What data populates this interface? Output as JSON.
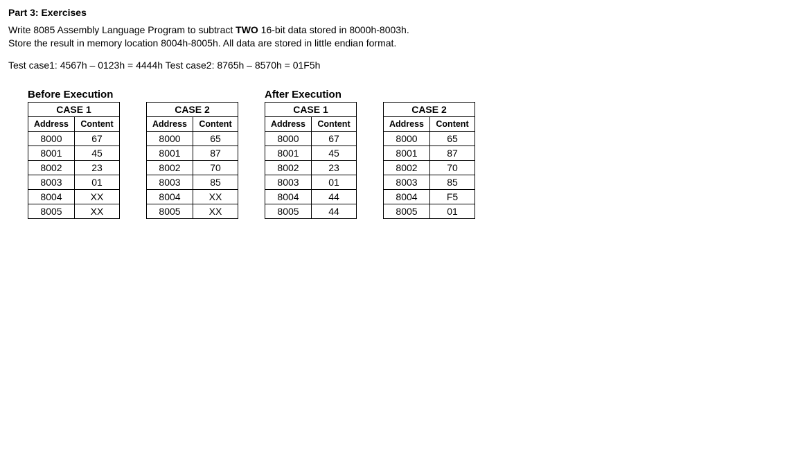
{
  "heading": "Part 3: Exercises",
  "desc_pre": "Write 8085 Assembly Language Program to subtract ",
  "two": "TWO",
  "desc_post": " 16-bit data stored in 8000h-8003h.",
  "desc_line2": "Store the result in memory location 8004h-8005h. All data are stored in little endian format.",
  "testcases": "Test case1: 4567h – 0123h = 4444h Test case2: 8765h – 8570h = 01F5h",
  "before_label": "Before Execution",
  "after_label": "After Execution",
  "addr_hdr": "Address",
  "cont_hdr": "Content",
  "before": [
    {
      "case_label": "CASE 1",
      "rows": [
        {
          "a": "8000",
          "c": "67"
        },
        {
          "a": "8001",
          "c": "45"
        },
        {
          "a": "8002",
          "c": "23"
        },
        {
          "a": "8003",
          "c": "01"
        },
        {
          "a": "8004",
          "c": "XX"
        },
        {
          "a": "8005",
          "c": "XX"
        }
      ]
    },
    {
      "case_label": "CASE 2",
      "rows": [
        {
          "a": "8000",
          "c": "65"
        },
        {
          "a": "8001",
          "c": "87"
        },
        {
          "a": "8002",
          "c": "70"
        },
        {
          "a": "8003",
          "c": "85"
        },
        {
          "a": "8004",
          "c": "XX"
        },
        {
          "a": "8005",
          "c": "XX"
        }
      ]
    }
  ],
  "after": [
    {
      "case_label": "CASE 1",
      "rows": [
        {
          "a": "8000",
          "c": "67"
        },
        {
          "a": "8001",
          "c": "45"
        },
        {
          "a": "8002",
          "c": "23"
        },
        {
          "a": "8003",
          "c": "01"
        },
        {
          "a": "8004",
          "c": "44"
        },
        {
          "a": "8005",
          "c": "44"
        }
      ]
    },
    {
      "case_label": "CASE 2",
      "rows": [
        {
          "a": "8000",
          "c": "65"
        },
        {
          "a": "8001",
          "c": "87"
        },
        {
          "a": "8002",
          "c": "70"
        },
        {
          "a": "8003",
          "c": "85"
        },
        {
          "a": "8004",
          "c": "F5"
        },
        {
          "a": "8005",
          "c": "01"
        }
      ]
    }
  ]
}
